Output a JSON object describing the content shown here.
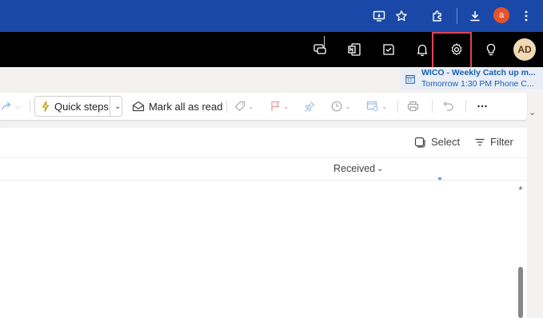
{
  "browser": {
    "profile_initial": "a"
  },
  "header": {
    "avatar_initials": "AD"
  },
  "reminder": {
    "title": "WICO - Weekly Catch up m...",
    "subtitle": "Tomorrow 1:30 PM Phone C..."
  },
  "toolbar": {
    "quick_steps_label": "Quick steps",
    "mark_all_read_label": "Mark all as read"
  },
  "message_list": {
    "select_label": "Select",
    "filter_label": "Filter",
    "sort_column_label": "Received"
  },
  "colors": {
    "browser_bar": "#1a48a8",
    "app_bar": "#000000",
    "highlight_outline": "#e0464f",
    "accent_link": "#1a5fb4"
  }
}
